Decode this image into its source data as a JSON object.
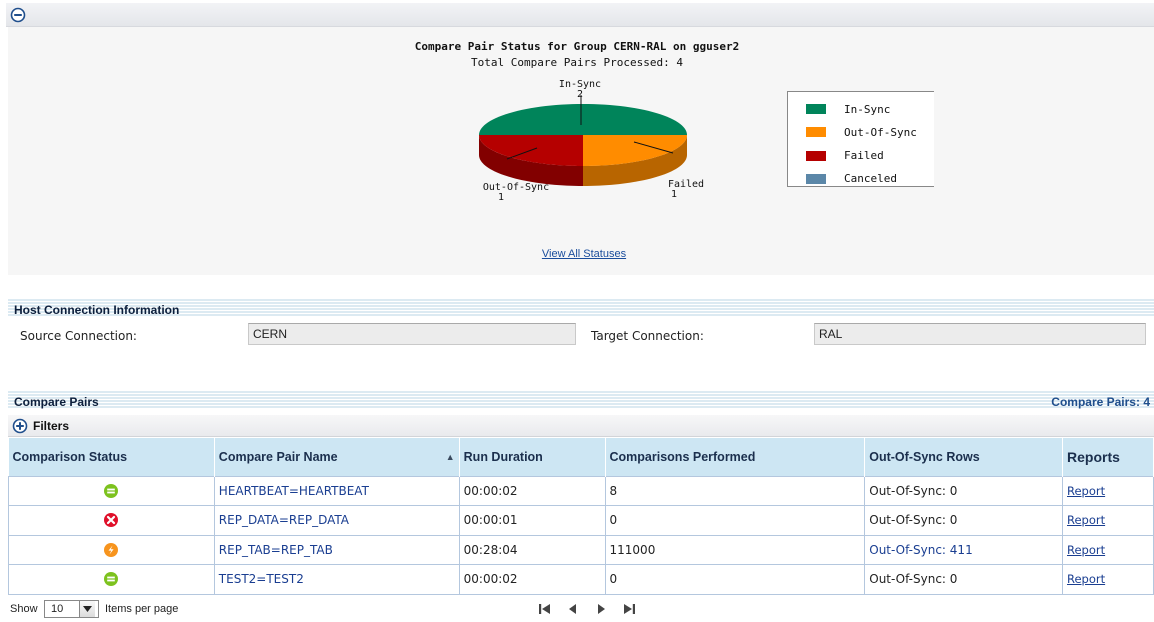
{
  "chart_panel": {
    "collapse_icon": "minus-circle-icon",
    "view_all_link": "View All Statuses"
  },
  "chart_data": {
    "type": "pie",
    "title": "Compare Pair Status for Group CERN-RAL on gguser2",
    "subtitle": "Total Compare Pairs Processed: 4",
    "slices": [
      {
        "name": "In-Sync",
        "value": 2,
        "color": "#00845a"
      },
      {
        "name": "Out-Of-Sync",
        "value": 1,
        "color": "#ff8c00"
      },
      {
        "name": "Failed",
        "value": 1,
        "color": "#b50000"
      },
      {
        "name": "Canceled",
        "value": 0,
        "color": "#5b87a8"
      }
    ],
    "slice_labels": [
      {
        "name": "In-Sync",
        "value": "2"
      },
      {
        "name": "Out-Of-Sync",
        "value": "1"
      },
      {
        "name": "Failed",
        "value": "1"
      }
    ],
    "legend": [
      "In-Sync",
      "Out-Of-Sync",
      "Failed",
      "Canceled"
    ],
    "legend_placement": "right"
  },
  "host": {
    "title": "Host Connection Information",
    "source_label": "Source Connection:",
    "source_value": "CERN",
    "target_label": "Target Connection:",
    "target_value": "RAL"
  },
  "compare_pairs": {
    "title": "Compare Pairs",
    "count_label": "Compare Pairs: 4",
    "filters_label": "Filters",
    "filters_icon": "plus-circle-icon",
    "columns": [
      "Comparison Status",
      "Compare Pair Name",
      "Run Duration",
      "Comparisons Performed",
      "Out-Of-Sync Rows",
      "Reports"
    ],
    "sort_indicator": "▲",
    "rows": [
      {
        "status_icon": "in-sync-icon",
        "status_color": "#7dc21e",
        "name": "HEARTBEAT=HEARTBEAT",
        "duration": "00:00:02",
        "comparisons": "8",
        "oos": "Out-Of-Sync: 0",
        "oos_link": false,
        "report": "Report"
      },
      {
        "status_icon": "failed-icon",
        "status_color": "#e0102a",
        "name": "REP_DATA=REP_DATA",
        "duration": "00:00:01",
        "comparisons": "0",
        "oos": "Out-Of-Sync: 0",
        "oos_link": false,
        "report": "Report"
      },
      {
        "status_icon": "out-of-sync-icon",
        "status_color": "#f7941d",
        "name": "REP_TAB=REP_TAB",
        "duration": "00:28:04",
        "comparisons": "111000",
        "oos": "Out-Of-Sync: 411",
        "oos_link": true,
        "report": "Report"
      },
      {
        "status_icon": "in-sync-icon",
        "status_color": "#7dc21e",
        "name": "TEST2=TEST2",
        "duration": "00:00:02",
        "comparisons": "0",
        "oos": "Out-Of-Sync: 0",
        "oos_link": false,
        "report": "Report"
      }
    ]
  },
  "pager": {
    "show_label": "Show",
    "per_page_value": "10",
    "items_label": "Items per page",
    "nav_icons": [
      "first-page-icon",
      "previous-page-icon",
      "next-page-icon",
      "last-page-icon"
    ]
  }
}
